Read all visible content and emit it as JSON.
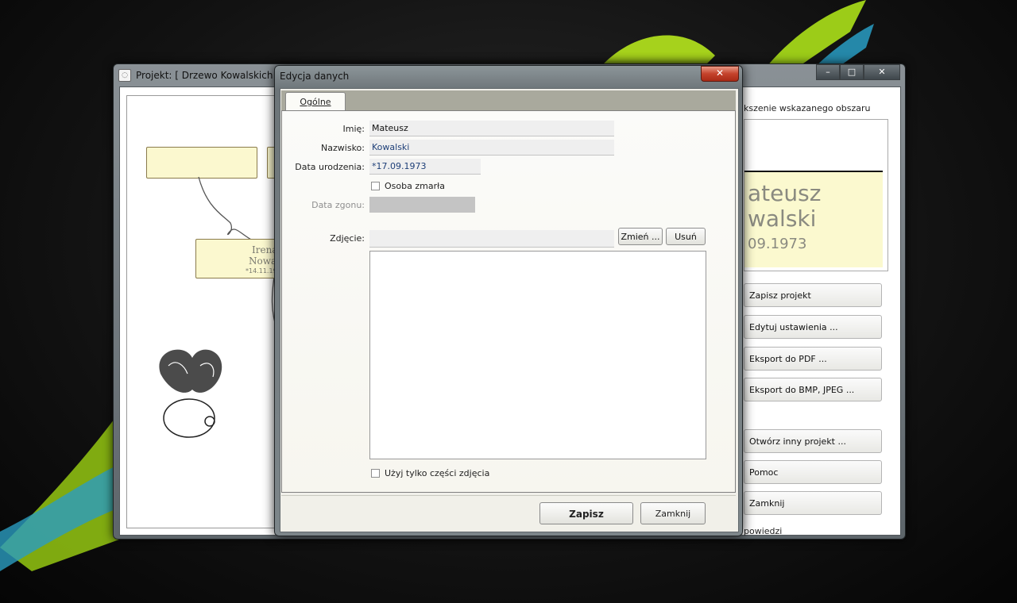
{
  "main_window": {
    "title": "Projekt: [ Drzewo Kowalskich ]",
    "controls": {
      "minimize": "–",
      "maximize": "□",
      "close": "✕"
    },
    "tree": {
      "person2_name_line1": "Irena",
      "person2_name_line2": "Nowa",
      "person2_date": "*14.11.19"
    },
    "preview": {
      "label": "kszenie wskazanego obszaru",
      "name_line1": "ateusz",
      "name_line2": "walski",
      "date": "09.1973"
    },
    "side_buttons": [
      "Zapisz projekt",
      "Edytuj ustawienia  ...",
      "Eksport do PDF ...",
      "Eksport do BMP, JPEG ...",
      "Otwórz inny projekt ...",
      "Pomoc",
      "Zamknij"
    ],
    "bottom_link": "powiedzi"
  },
  "dialog": {
    "title": "Edycja danych",
    "close_glyph": "✕",
    "tab_label": "Ogólne",
    "fields": {
      "first_name_label": "Imię:",
      "first_name_value": "Mateusz",
      "last_name_label": "Nazwisko:",
      "last_name_value": "Kowalski",
      "birth_label": "Data urodzenia:",
      "birth_value": "*17.09.1973",
      "deceased_label": "Osoba zmarła",
      "death_label": "Data zgonu:",
      "death_value": "",
      "photo_label": "Zdjęcie:",
      "photo_value": ""
    },
    "photo_buttons": {
      "change": "Zmień ...",
      "remove": "Usuń"
    },
    "partial_photo_label": "Użyj tylko części zdjęcia",
    "footer": {
      "save": "Zapisz",
      "close": "Zamknij"
    }
  },
  "colors": {
    "accent_green": "#a6d21c",
    "desktop_bg": "#141414",
    "scroll_fill": "#fbf8cf"
  }
}
